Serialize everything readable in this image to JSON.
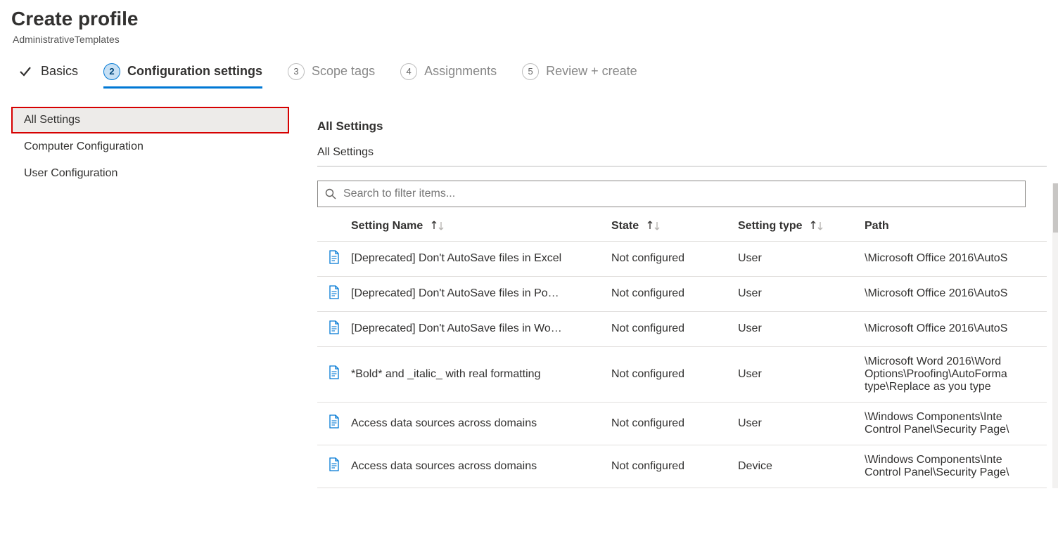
{
  "header": {
    "title": "Create profile",
    "subtitle": "AdministrativeTemplates"
  },
  "wizard": {
    "steps": [
      {
        "label": "Basics",
        "state": "done"
      },
      {
        "label": "Configuration settings",
        "state": "active",
        "num": "2"
      },
      {
        "label": "Scope tags",
        "state": "future",
        "num": "3"
      },
      {
        "label": "Assignments",
        "state": "future",
        "num": "4"
      },
      {
        "label": "Review + create",
        "state": "future",
        "num": "5"
      }
    ]
  },
  "sidebar": {
    "items": [
      {
        "label": "All Settings",
        "selected": true
      },
      {
        "label": "Computer Configuration",
        "selected": false
      },
      {
        "label": "User Configuration",
        "selected": false
      }
    ]
  },
  "main": {
    "section_title": "All Settings",
    "breadcrumb": "All Settings",
    "search": {
      "placeholder": "Search to filter items..."
    },
    "columns": {
      "name": "Setting Name",
      "state": "State",
      "type": "Setting type",
      "path": "Path"
    },
    "rows": [
      {
        "name": "[Deprecated] Don't AutoSave files in Excel",
        "state": "Not configured",
        "type": "User",
        "path": "\\Microsoft Office 2016\\AutoS"
      },
      {
        "name": "[Deprecated] Don't AutoSave files in Po…",
        "state": "Not configured",
        "type": "User",
        "path": "\\Microsoft Office 2016\\AutoS"
      },
      {
        "name": "[Deprecated] Don't AutoSave files in Wo…",
        "state": "Not configured",
        "type": "User",
        "path": "\\Microsoft Office 2016\\AutoS"
      },
      {
        "name": "*Bold* and _italic_ with real formatting",
        "state": "Not configured",
        "type": "User",
        "path": "\\Microsoft Word 2016\\Word Options\\Proofing\\AutoForma type\\Replace as you type"
      },
      {
        "name": "Access data sources across domains",
        "state": "Not configured",
        "type": "User",
        "path": "\\Windows Components\\Inte Control Panel\\Security Page\\"
      },
      {
        "name": "Access data sources across domains",
        "state": "Not configured",
        "type": "Device",
        "path": "\\Windows Components\\Inte Control Panel\\Security Page\\"
      }
    ]
  }
}
